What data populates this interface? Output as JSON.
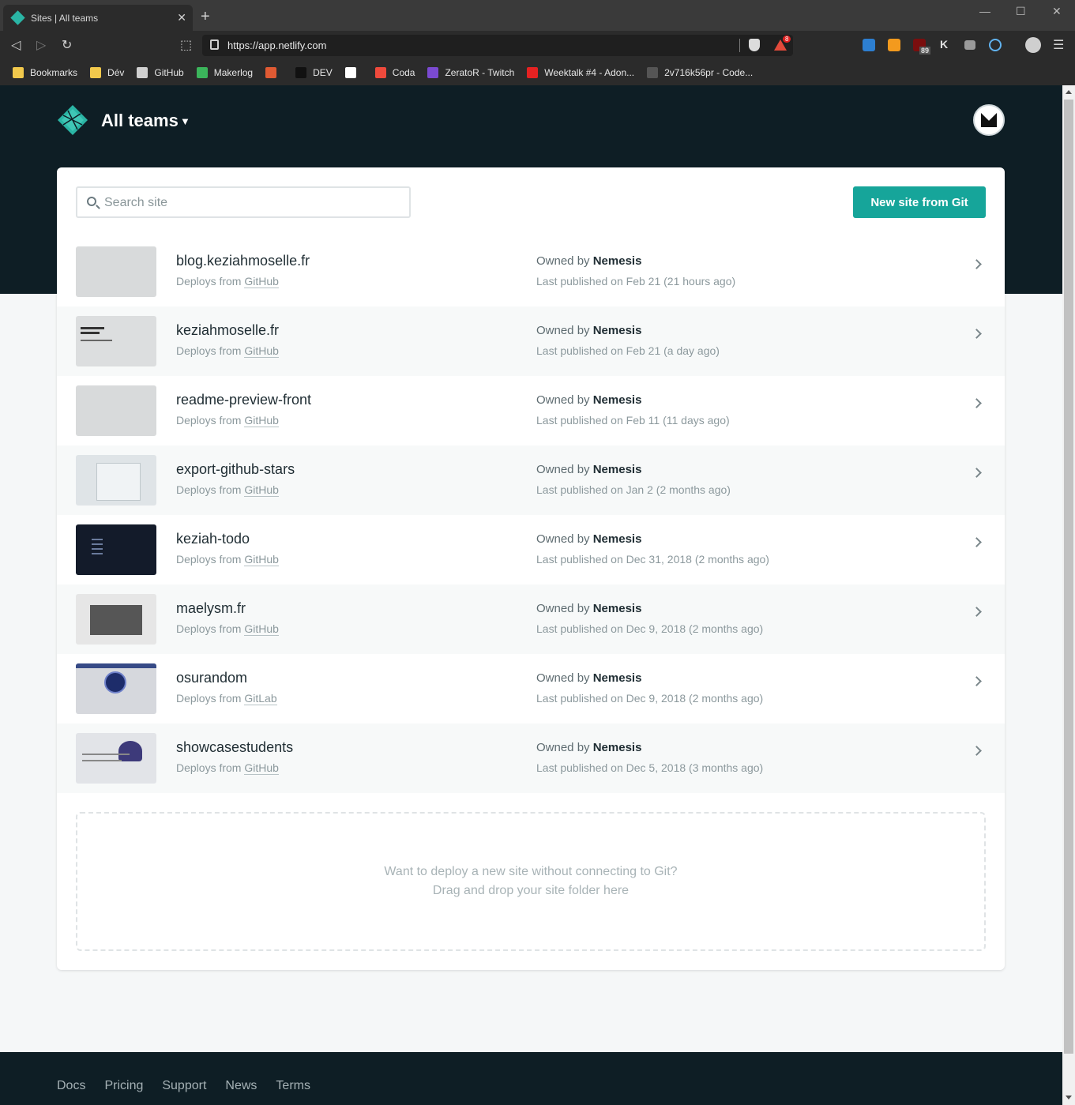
{
  "browser": {
    "tab_title": "Sites | All teams",
    "url": "https://app.netlify.com",
    "brave_badge": "8",
    "ext_badge": "89",
    "bookmarks": [
      {
        "label": "Bookmarks",
        "color": "#f2c94c"
      },
      {
        "label": "Dév",
        "color": "#f2c94c"
      },
      {
        "label": "GitHub",
        "color": "#d0d0d0"
      },
      {
        "label": "Makerlog",
        "color": "#3bb55b"
      },
      {
        "label": "",
        "color": "#e05a33"
      },
      {
        "label": "DEV",
        "color": "#111111"
      },
      {
        "label": "",
        "color": "#ffffff"
      },
      {
        "label": "Coda",
        "color": "#ef4a3c"
      },
      {
        "label": "ZeratoR - Twitch",
        "color": "#7b4ad1"
      },
      {
        "label": "Weektalk #4 - Adon...",
        "color": "#e52222"
      },
      {
        "label": "2v716k56pr - Code...",
        "color": "#555555"
      }
    ]
  },
  "header": {
    "team_label": "All teams"
  },
  "search": {
    "placeholder": "Search site",
    "value": ""
  },
  "actions": {
    "new_site": "New site from Git"
  },
  "labels": {
    "deploys_from": "Deploys from",
    "owned_by": "Owned by"
  },
  "sites": [
    {
      "name": "blog.keziahmoselle.fr",
      "provider": "GitHub",
      "owner": "Nemesis",
      "published": "Last published on Feb 21 (21 hours ago)",
      "thumb": "blank"
    },
    {
      "name": "keziahmoselle.fr",
      "provider": "GitHub",
      "owner": "Nemesis",
      "published": "Last published on Feb 21 (a day ago)",
      "thumb": "text"
    },
    {
      "name": "readme-preview-front",
      "provider": "GitHub",
      "owner": "Nemesis",
      "published": "Last published on Feb 11 (11 days ago)",
      "thumb": "blank"
    },
    {
      "name": "export-github-stars",
      "provider": "GitHub",
      "owner": "Nemesis",
      "published": "Last published on Jan 2 (2 months ago)",
      "thumb": "window"
    },
    {
      "name": "keziah-todo",
      "provider": "GitHub",
      "owner": "Nemesis",
      "published": "Last published on Dec 31, 2018 (2 months ago)",
      "thumb": "dark"
    },
    {
      "name": "maelysm.fr",
      "provider": "GitHub",
      "owner": "Nemesis",
      "published": "Last published on Dec 9, 2018 (2 months ago)",
      "thumb": "photo"
    },
    {
      "name": "osurandom",
      "provider": "GitLab",
      "owner": "Nemesis",
      "published": "Last published on Dec 9, 2018 (2 months ago)",
      "thumb": "circle"
    },
    {
      "name": "showcasestudents",
      "provider": "GitHub",
      "owner": "Nemesis",
      "published": "Last published on Dec 5, 2018 (3 months ago)",
      "thumb": "figure"
    }
  ],
  "dropzone": {
    "line1": "Want to deploy a new site without connecting to Git?",
    "line2": "Drag and drop your site folder here"
  },
  "footer": {
    "links": [
      "Docs",
      "Pricing",
      "Support",
      "News",
      "Terms"
    ]
  },
  "colors": {
    "brand_dark": "#0e1e25",
    "accent": "#16a59a"
  }
}
